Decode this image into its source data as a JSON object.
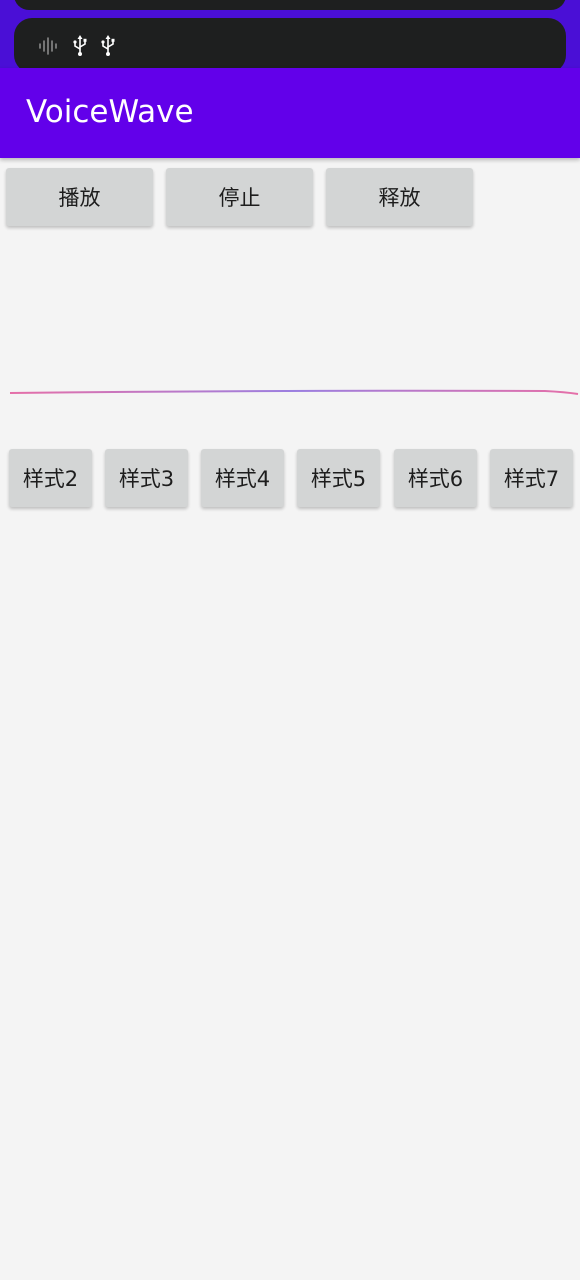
{
  "app": {
    "title": "VoiceWave"
  },
  "notification_icons": [
    "waveform-icon",
    "usb-icon",
    "usb-icon"
  ],
  "controls": {
    "play": "播放",
    "stop": "停止",
    "release": "释放"
  },
  "styles": [
    "样式2",
    "样式3",
    "样式4",
    "样式5",
    "样式6",
    "样式7"
  ],
  "colors": {
    "app_bar": "#6200ea",
    "status_bar": "#4a0fd6",
    "background": "#f4f4f4",
    "button": "#d3d5d5",
    "wave_start": "#e56fa8",
    "wave_mid": "#9b7fe0",
    "wave_end": "#e56fa8"
  }
}
